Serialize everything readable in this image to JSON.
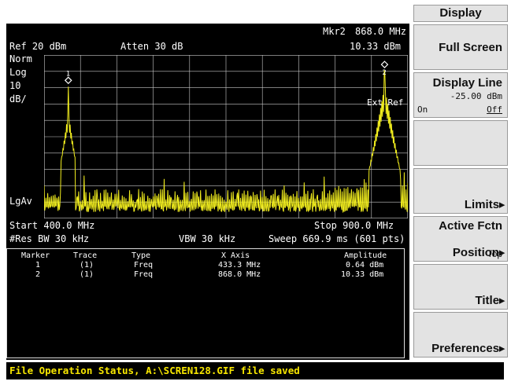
{
  "header": {
    "marker_readout_label": "Mkr2",
    "marker_readout_freq": "868.0 MHz",
    "marker_readout_amp": "10.33 dBm",
    "ref_level": "Ref 20 dBm",
    "attenuation": "Atten 30 dB"
  },
  "scale": {
    "norm": "Norm",
    "log": "Log",
    "per_div_value": "10",
    "per_div_unit": "dB/",
    "detector": "LgAv"
  },
  "graph_annotations": {
    "marker1_label": "1",
    "marker2_label": "2",
    "ext_ref": "Ext Ref"
  },
  "footer": {
    "start": "Start 400.0 MHz",
    "stop": "Stop 900.0 MHz",
    "res_bw": "#Res BW 30 kHz",
    "vbw": "VBW 30 kHz",
    "sweep": "Sweep 669.9 ms (601 pts)"
  },
  "marker_table": {
    "headers": [
      "Marker",
      "Trace",
      "Type",
      "X Axis",
      "Amplitude"
    ],
    "rows": [
      [
        "1",
        "(1)",
        "Freq",
        "433.3 MHz",
        "0.64 dBm"
      ],
      [
        "2",
        "(1)",
        "Freq",
        "868.0 MHz",
        "10.33 dBm"
      ]
    ]
  },
  "status": {
    "text": "File Operation Status, A:\\SCREN128.GIF file saved"
  },
  "menu": {
    "title": "Display",
    "full_screen": "Full Screen",
    "display_line": "Display Line",
    "display_line_value": "-25.00 dBm",
    "display_line_on": "On",
    "display_line_off": "Off",
    "limits": "Limits",
    "active_fctn_line1": "Active Fctn",
    "active_fctn_line2": "Position",
    "active_fctn_value": "Top",
    "title_key": "Title",
    "preferences": "Preferences"
  },
  "colors": {
    "trace": "#f2ee1e",
    "graticule": "#c8c8c8",
    "status_text": "#f7e600",
    "softkey_bg": "#e3e3e3"
  },
  "chart_data": {
    "type": "line",
    "x_unit": "MHz",
    "y_unit": "dBm",
    "x_range": [
      400.0,
      900.0
    ],
    "y_range": [
      -80,
      20
    ],
    "ref_level": 20,
    "scale_per_div": 10,
    "markers": [
      {
        "name": "1",
        "x": 433.3,
        "y": 0.64
      },
      {
        "name": "2",
        "x": 868.0,
        "y": 10.33
      }
    ],
    "noise_floor": -76,
    "grid": true
  }
}
